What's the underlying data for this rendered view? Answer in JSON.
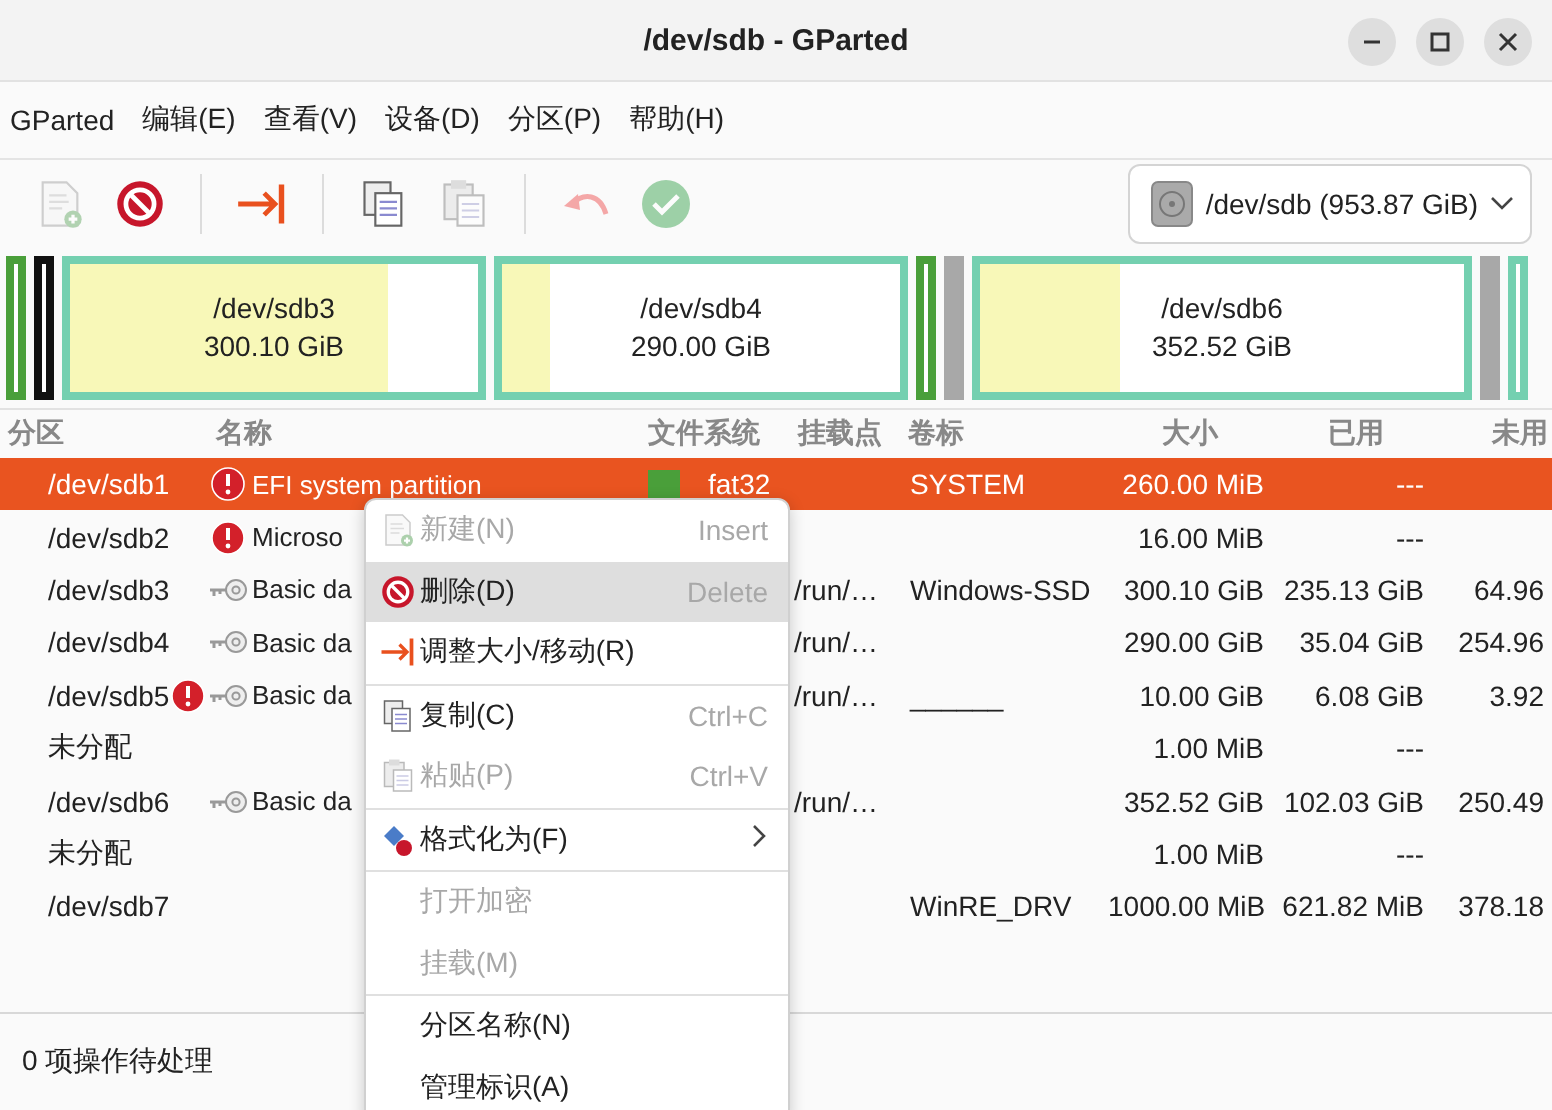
{
  "window": {
    "title": "/dev/sdb - GParted"
  },
  "menubar": [
    {
      "label": "GParted"
    },
    {
      "label": "编辑(E)"
    },
    {
      "label": "查看(V)"
    },
    {
      "label": "设备(D)"
    },
    {
      "label": "分区(P)"
    },
    {
      "label": "帮助(H)"
    }
  ],
  "toolbar": [
    {
      "disabled": true
    },
    {
      "disabled": false
    },
    {
      "disabled": false
    },
    {
      "disabled": false
    },
    {
      "disabled": true
    },
    {
      "disabled": true
    },
    {
      "disabled": true
    }
  ],
  "device_selector": {
    "value": "/dev/sdb (953.87 GiB)"
  },
  "disk_map": {
    "segments": [
      {
        "kind": "partition",
        "color": "#4a9f3a"
      },
      {
        "kind": "partition",
        "color": "#111111"
      },
      {
        "kind": "partition",
        "color": "#74d0b0",
        "label": "/dev/sdb3",
        "size": "300.10 GiB",
        "level": 0.78
      },
      {
        "kind": "partition",
        "color": "#74d0b0",
        "label": "/dev/sdb4",
        "size": "290.00 GiB",
        "level": 0.12
      },
      {
        "kind": "partition",
        "color": "#4a9f3a"
      },
      {
        "kind": "unallocated"
      },
      {
        "kind": "partition",
        "color": "#74d0b0",
        "label": "/dev/sdb6",
        "size": "352.52 GiB",
        "level": 0.29
      },
      {
        "kind": "unallocated"
      },
      {
        "kind": "partition",
        "color": "#74d0b0"
      }
    ]
  },
  "table": {
    "columns": [
      "分区",
      "名称",
      "文件系统",
      "挂载点",
      "卷标",
      "大小",
      "已用",
      "未用"
    ],
    "rows": [
      {
        "partition": "/dev/sdb1",
        "warning": true,
        "mounted": false,
        "name": "EFI system partition",
        "filesystem": "fat32",
        "color": "#4a9f3a",
        "label": "SYSTEM",
        "size": "260.00 MiB",
        "used": "---",
        "selected": true
      },
      {
        "partition": "/dev/sdb2",
        "warning": true,
        "mounted": false,
        "name": "Microso",
        "size": "16.00 MiB",
        "used": "---",
        "selected": false
      },
      {
        "partition": "/dev/sdb3",
        "warning": false,
        "mounted": true,
        "name": "Basic da",
        "mount_point": "/run/…",
        "label": "Windows-SSD",
        "size": "300.10 GiB",
        "used": "235.13 GiB",
        "unused": "64.96",
        "selected": false
      },
      {
        "partition": "/dev/sdb4",
        "warning": false,
        "mounted": true,
        "name": "Basic da",
        "mount_point": "/run/…",
        "size": "290.00 GiB",
        "used": "35.04 GiB",
        "unused": "254.96",
        "selected": false
      },
      {
        "partition": "/dev/sdb5",
        "warning": true,
        "mounted": true,
        "name": "Basic da",
        "mount_point": "/run/…",
        "label": "______",
        "size": "10.00 GiB",
        "used": "6.08 GiB",
        "unused": "3.92",
        "selected": false
      },
      {
        "partition": "未分配",
        "warning": false,
        "mounted": false,
        "size": "1.00 MiB",
        "used": "---",
        "selected": false
      },
      {
        "partition": "/dev/sdb6",
        "warning": false,
        "mounted": true,
        "name": "Basic da",
        "mount_point": "/run/…",
        "size": "352.52 GiB",
        "used": "102.03 GiB",
        "unused": "250.49",
        "selected": false
      },
      {
        "partition": "未分配",
        "warning": false,
        "mounted": false,
        "size": "1.00 MiB",
        "used": "---",
        "selected": false
      },
      {
        "partition": "/dev/sdb7",
        "warning": false,
        "mounted": false,
        "label": "WinRE_DRV",
        "size": "1000.00 MiB",
        "used": "621.82 MiB",
        "unused": "378.18",
        "selected": false
      }
    ]
  },
  "context_menu": {
    "items": [
      {
        "kind": "item",
        "label": "新建(N)",
        "shortcut": "Insert",
        "disabled": true,
        "selected": false
      },
      {
        "kind": "item",
        "label": "删除(D)",
        "shortcut": "Delete",
        "disabled": false,
        "selected": true
      },
      {
        "kind": "item",
        "label": "调整大小/移动(R)",
        "disabled": false,
        "selected": false
      },
      {
        "kind": "separator"
      },
      {
        "kind": "item",
        "label": "复制(C)",
        "shortcut": "Ctrl+C",
        "disabled": false,
        "selected": false
      },
      {
        "kind": "item",
        "label": "粘贴(P)",
        "shortcut": "Ctrl+V",
        "disabled": true,
        "selected": false
      },
      {
        "kind": "separator"
      },
      {
        "kind": "item",
        "label": "格式化为(F)",
        "submenu": true,
        "disabled": false,
        "selected": false
      },
      {
        "kind": "separator"
      },
      {
        "kind": "item",
        "label": "打开加密",
        "disabled": true,
        "selected": false
      },
      {
        "kind": "item",
        "label": "挂载(M)",
        "disabled": true,
        "selected": false
      },
      {
        "kind": "separator"
      },
      {
        "kind": "item",
        "label": "分区名称(N)",
        "disabled": false,
        "selected": false
      },
      {
        "kind": "item",
        "label": "管理标识(A)",
        "disabled": false,
        "selected": false
      }
    ]
  },
  "status_bar": {
    "text": "0 项操作待处理"
  }
}
